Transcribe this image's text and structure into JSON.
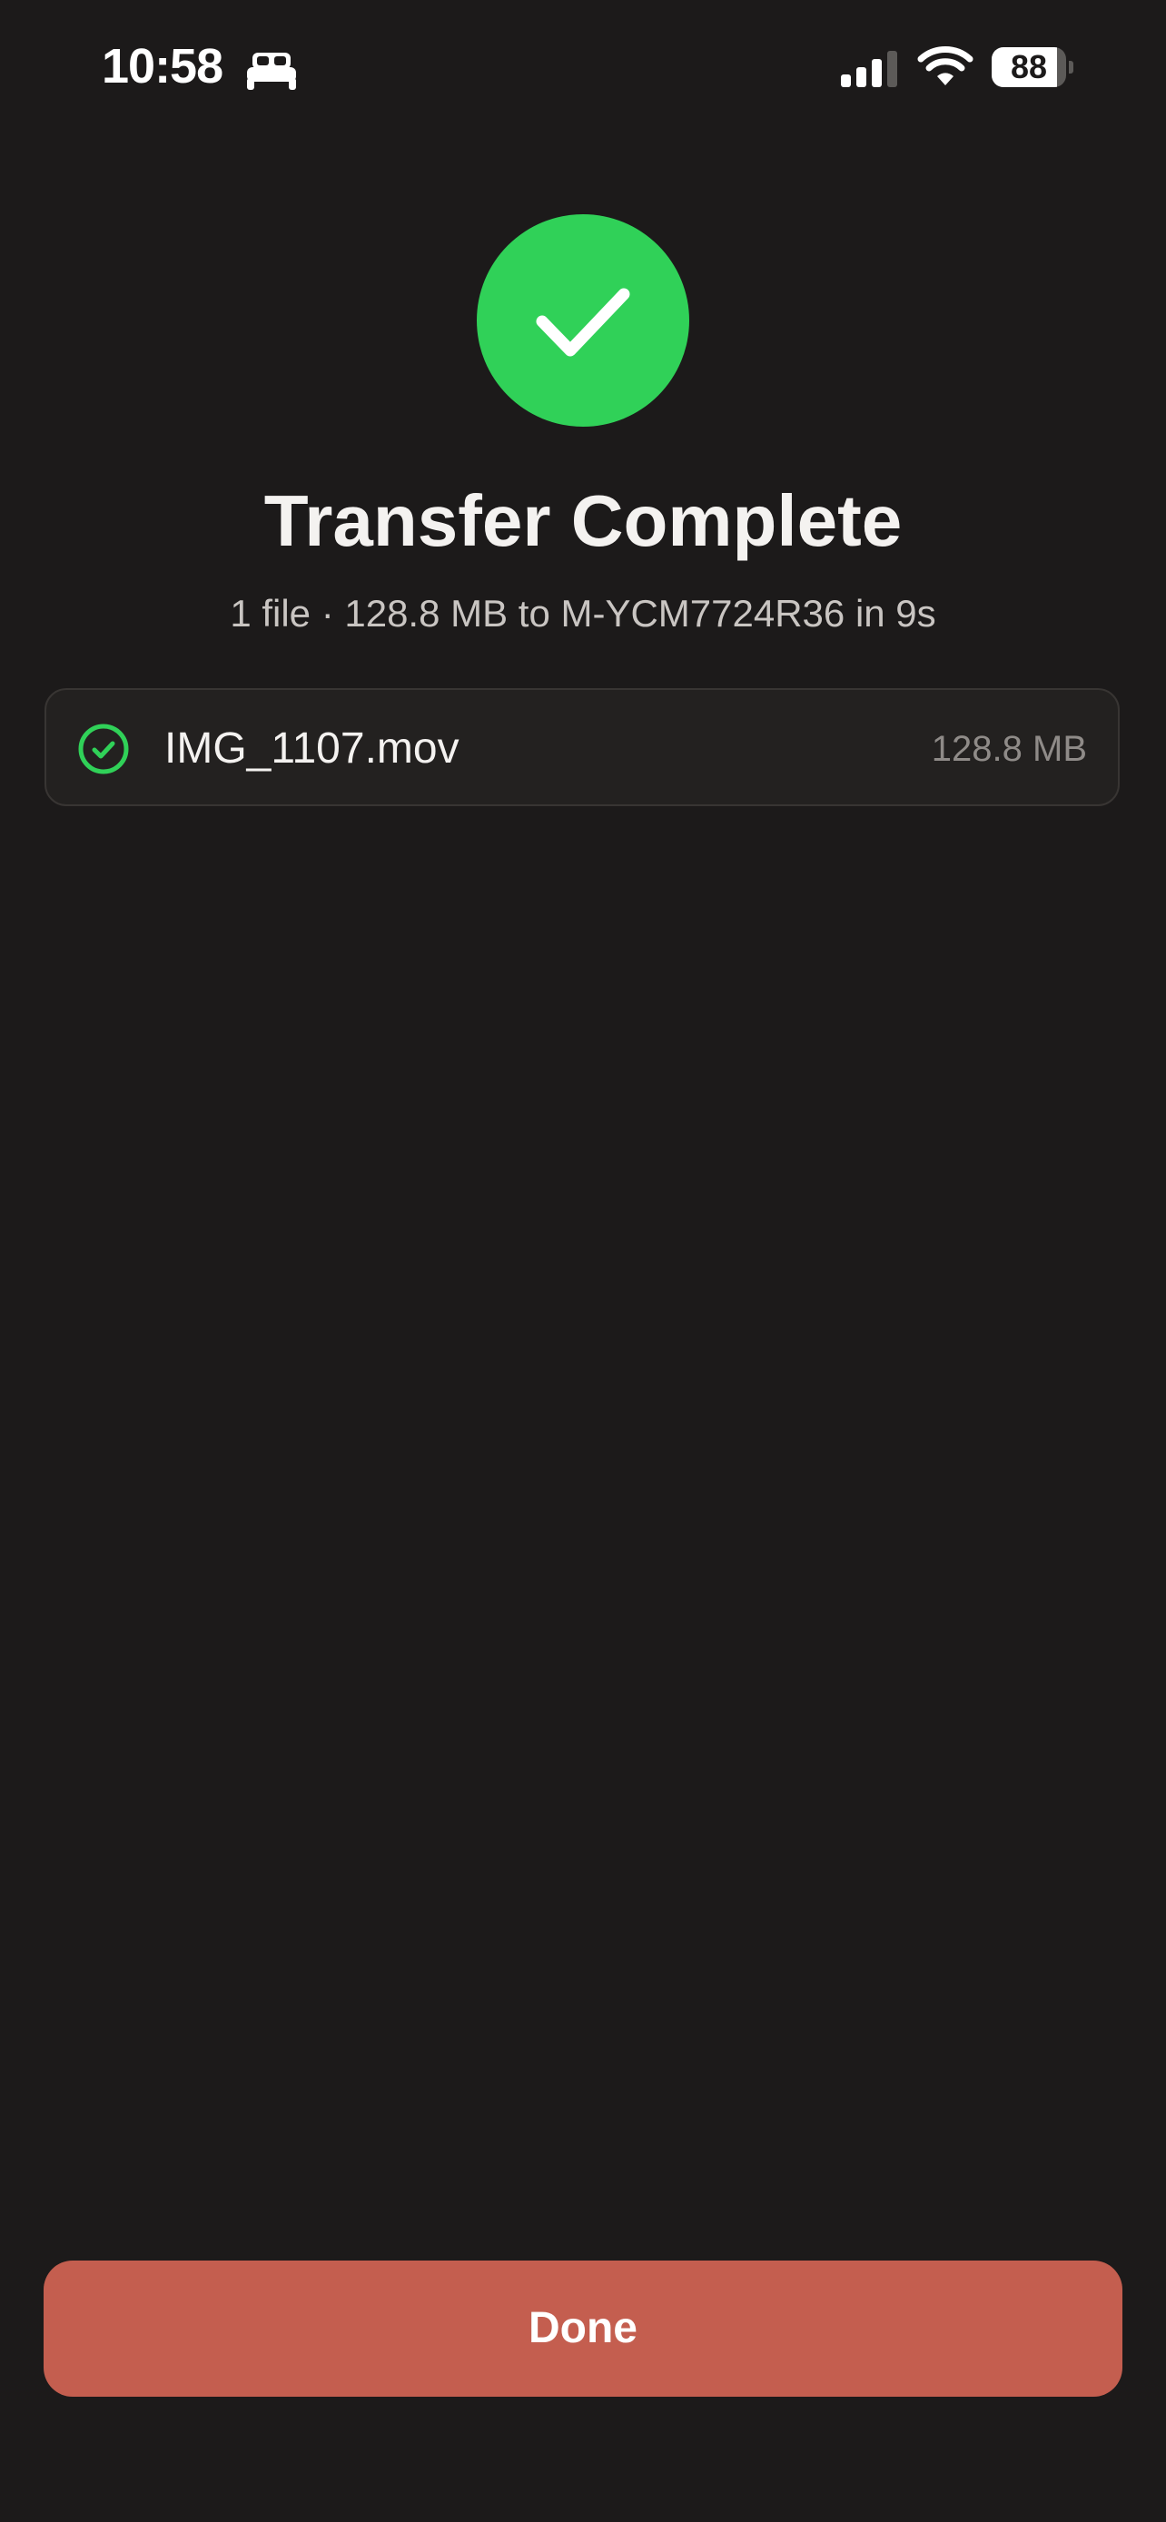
{
  "status_bar": {
    "time": "10:58",
    "battery_level": 88,
    "battery_label": "88",
    "icons": [
      "bed-icon",
      "cellular-signal-icon",
      "wifi-icon",
      "battery-icon"
    ]
  },
  "colors": {
    "background": "#1c1a1a",
    "success": "#30d158",
    "button": "#c45e4f",
    "card": "#232120"
  },
  "result": {
    "title": "Transfer Complete",
    "summary": "1 file · 128.8 MB to M-YCM7724R36 in 9s"
  },
  "files": [
    {
      "name": "IMG_1107.mov",
      "size": "128.8 MB",
      "status_icon": "check-circle-icon"
    }
  ],
  "actions": {
    "done_label": "Done"
  }
}
